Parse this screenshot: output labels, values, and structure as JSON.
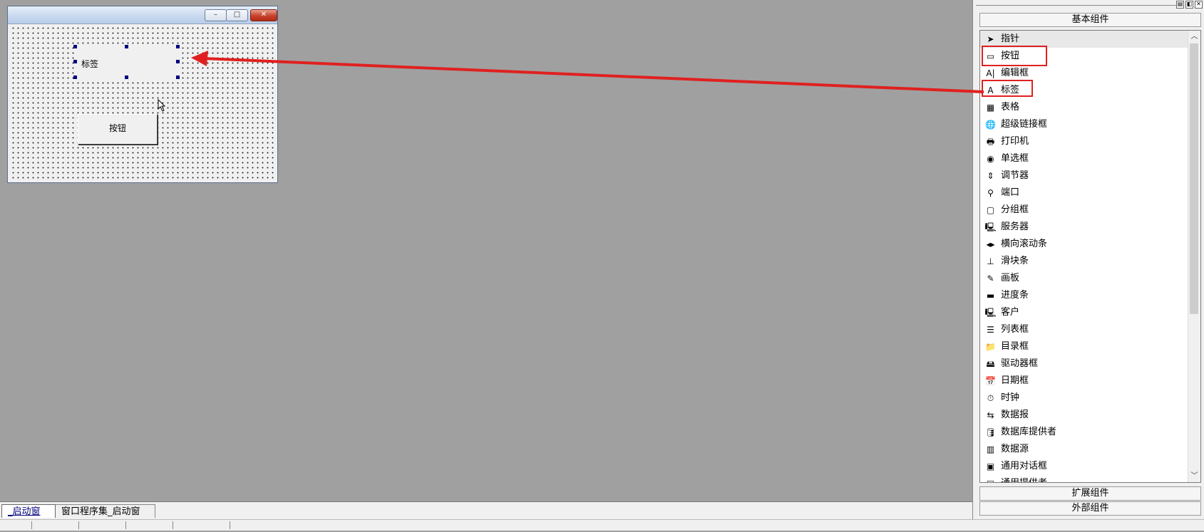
{
  "form": {
    "label_text": "标签",
    "button_text": "按钮",
    "window_buttons": {
      "minimize": "–",
      "maximize": "□",
      "close": "✕"
    }
  },
  "toolbox": {
    "top_controls": [
      "▤",
      "◧",
      "✕"
    ],
    "section_basic": "基本组件",
    "section_ext": "扩展组件",
    "section_external": "外部组件",
    "items": [
      {
        "label": "指针",
        "icon": "pointer-icon",
        "glyph": "➤"
      },
      {
        "label": "按钮",
        "icon": "button-icon",
        "glyph": "▭"
      },
      {
        "label": "编辑框",
        "icon": "edit-box-icon",
        "glyph": "A|"
      },
      {
        "label": "标签",
        "icon": "label-icon",
        "glyph": "A"
      },
      {
        "label": "表格",
        "icon": "table-icon",
        "glyph": "▦"
      },
      {
        "label": "超级链接框",
        "icon": "hyperlink-icon",
        "glyph": "🌐"
      },
      {
        "label": "打印机",
        "icon": "printer-icon",
        "glyph": "🖶"
      },
      {
        "label": "单选框",
        "icon": "radio-icon",
        "glyph": "◉"
      },
      {
        "label": "调节器",
        "icon": "spinner-icon",
        "glyph": "⇕"
      },
      {
        "label": "端口",
        "icon": "port-icon",
        "glyph": "⚲"
      },
      {
        "label": "分组框",
        "icon": "group-box-icon",
        "glyph": "▢"
      },
      {
        "label": "服务器",
        "icon": "server-icon",
        "glyph": "🖳"
      },
      {
        "label": "横向滚动条",
        "icon": "hscroll-icon",
        "glyph": "◂▸"
      },
      {
        "label": "滑块条",
        "icon": "slider-icon",
        "glyph": "⊥"
      },
      {
        "label": "画板",
        "icon": "canvas-icon",
        "glyph": "✎"
      },
      {
        "label": "进度条",
        "icon": "progress-icon",
        "glyph": "▬"
      },
      {
        "label": "客户",
        "icon": "client-icon",
        "glyph": "🖳"
      },
      {
        "label": "列表框",
        "icon": "listbox-icon",
        "glyph": "☰"
      },
      {
        "label": "目录框",
        "icon": "directory-icon",
        "glyph": "📁"
      },
      {
        "label": "驱动器框",
        "icon": "drive-icon",
        "glyph": "🖴"
      },
      {
        "label": "日期框",
        "icon": "date-icon",
        "glyph": "📅"
      },
      {
        "label": "时钟",
        "icon": "clock-icon",
        "glyph": "⏱"
      },
      {
        "label": "数据报",
        "icon": "datagram-icon",
        "glyph": "⇆"
      },
      {
        "label": "数据库提供者",
        "icon": "db-provider-icon",
        "glyph": "🛢"
      },
      {
        "label": "数据源",
        "icon": "datasource-icon",
        "glyph": "▥"
      },
      {
        "label": "通用对话框",
        "icon": "common-dialog-icon",
        "glyph": "▣"
      },
      {
        "label": "通用提供者",
        "icon": "common-provider-icon",
        "glyph": "▤"
      }
    ],
    "scroll_up": "︿",
    "scroll_down": "﹀"
  },
  "tabs": [
    "_启动窗口",
    "窗口程序集_启动窗口"
  ],
  "colors": {
    "highlight": "#e02020",
    "arrow": "#e02020",
    "workspace": "#a0a0a0"
  }
}
